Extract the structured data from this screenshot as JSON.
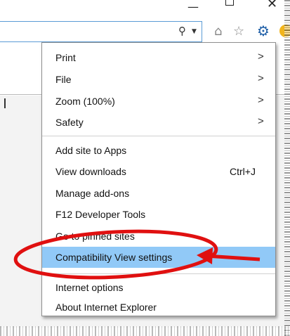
{
  "window": {
    "minimize_symbol": "—",
    "close_symbol": "✕"
  },
  "address_bar": {
    "search_icon": "search-icon",
    "dropdown_icon": "chevron-down-icon"
  },
  "toolbar": {
    "icons": [
      "home-icon",
      "star-icon",
      "gear-icon",
      "smiley-icon"
    ]
  },
  "menu": {
    "items": [
      {
        "label": "Print",
        "submenu": true
      },
      {
        "label": "File",
        "submenu": true
      },
      {
        "label": "Zoom (100%)",
        "submenu": true
      },
      {
        "label": "Safety",
        "submenu": true
      },
      {
        "label": "Add site to Apps"
      },
      {
        "label": "View downloads",
        "shortcut": "Ctrl+J"
      },
      {
        "label": "Manage add-ons"
      },
      {
        "label": "F12 Developer Tools"
      },
      {
        "label": "Go to pinned sites"
      },
      {
        "label": "Compatibility View settings",
        "highlighted": true
      },
      {
        "label": "Internet options"
      },
      {
        "label": "About Internet Explorer"
      }
    ],
    "arrow_glyph": ">"
  },
  "annotation": {
    "circle_color": "#e01010",
    "arrow_color": "#e01010"
  }
}
